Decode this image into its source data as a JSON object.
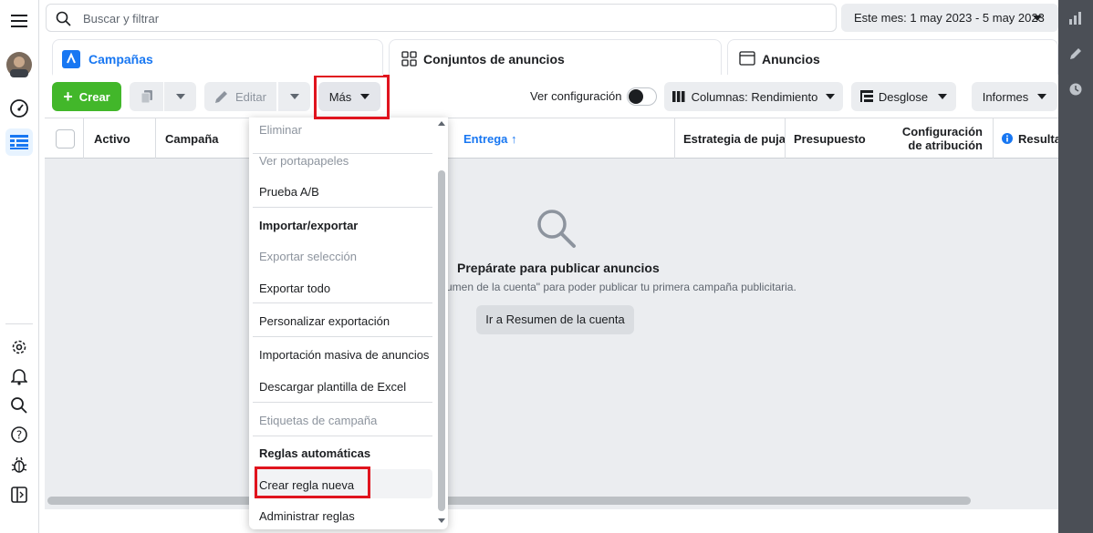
{
  "search": {
    "placeholder": "Buscar y filtrar"
  },
  "date_range": "Este mes: 1 may 2023 - 5 may 2023",
  "tabs": [
    {
      "label": "Campañas"
    },
    {
      "label": "Conjuntos de anuncios"
    },
    {
      "label": "Anuncios"
    }
  ],
  "toolbar": {
    "create_label": "Crear",
    "edit_label": "Editar",
    "more_label": "Más",
    "view_config_label": "Ver configuración",
    "columns_label": "Columnas: Rendimiento",
    "breakdown_label": "Desglose",
    "reports_label": "Informes"
  },
  "table": {
    "columns": [
      "Activo",
      "Campaña",
      "Entrega ↑",
      "Estrategia de puja",
      "Presupuesto",
      "Configuración",
      "de atribución",
      "Resultados"
    ]
  },
  "empty_state": {
    "title": "Prepárate para publicar anuncios",
    "subtitle": "sumen de la cuenta\" para poder publicar tu primera campaña publicitaria.",
    "button_label": "Ir a Resumen de la cuenta"
  },
  "menu": {
    "items": [
      "Eliminar",
      "Ver portapapeles",
      "Prueba A/B",
      "Importar/exportar",
      "Exportar selección",
      "Exportar todo",
      "Personalizar exportación",
      "Importación masiva de anuncios",
      "Descargar plantilla de Excel",
      "Etiquetas de campaña",
      "Reglas automáticas",
      "Crear regla nueva",
      "Administrar reglas"
    ]
  },
  "colors": {
    "accent": "#1877f2",
    "create_green": "#42b72a",
    "highlight_red": "#e0141e"
  }
}
